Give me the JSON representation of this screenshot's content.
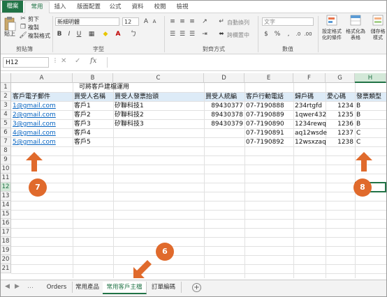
{
  "ribbon_tabs": [
    "檔案",
    "常用",
    "插入",
    "版面配置",
    "公式",
    "資料",
    "校閱",
    "檢視"
  ],
  "clipboard": {
    "paste": "貼上",
    "cut": "剪下",
    "copy": "複製",
    "format_painter": "複製格式",
    "group_label": "剪貼簿"
  },
  "font": {
    "name": "新細明體",
    "size": "12",
    "group_label": "字型"
  },
  "alignment": {
    "wrap": "自動換列",
    "merge": "跨欄置中",
    "group_label": "對齊方式"
  },
  "number": {
    "format": "文字",
    "group_label": "數值"
  },
  "styles": {
    "conditional": "設定格式化的條件",
    "format_table": "格式化為表格",
    "cell_styles": "儲存格樣式"
  },
  "formula_bar": {
    "name_box": "H12",
    "fx": "fx",
    "cancel": "✕",
    "confirm": "✓",
    "value": ""
  },
  "columns": [
    "A",
    "B",
    "C",
    "D",
    "E",
    "F",
    "G",
    "H"
  ],
  "rows": [
    "1",
    "2",
    "3",
    "4",
    "5",
    "6",
    "7",
    "8",
    "9",
    "10",
    "11",
    "12",
    "13",
    "14",
    "15",
    "16",
    "17",
    "18",
    "19",
    "20",
    "21"
  ],
  "title": "可將客戶建檔運用",
  "headers": [
    "客戶電子郵件",
    "買受人名稱",
    "買受人發票抬頭",
    "買受人統編",
    "客戶行動電話",
    "歸戶碼",
    "愛心碼",
    "發票類型"
  ],
  "data_rows": [
    [
      "1@gmail.com",
      "客戶1",
      "矽聯科技1",
      "89430377",
      "07-7190888",
      "234rtgfd",
      "1234",
      "B"
    ],
    [
      "2@gmail.com",
      "客戶2",
      "矽聯科技2",
      "89430378",
      "07-7190889",
      "1qwer432",
      "1235",
      "B"
    ],
    [
      "3@gmail.com",
      "客戶3",
      "矽聯科技3",
      "89430379",
      "07-7190890",
      "1234rewq",
      "1236",
      "B"
    ],
    [
      "4@gmail.com",
      "客戶4",
      "",
      "",
      "07-7190891",
      "aq12wsde",
      "1237",
      "C"
    ],
    [
      "5@gmail.com",
      "客戶5",
      "",
      "",
      "07-7190892",
      "12wsxzaq",
      "1238",
      "C"
    ]
  ],
  "annotations": {
    "badge_6": "6",
    "badge_7": "7",
    "badge_8": "8",
    "color": "#e06a2c"
  },
  "sheets": {
    "tabs": [
      "Orders",
      "常用產品",
      "常用客戶主檔",
      "訂單編碼"
    ],
    "active": "常用客戶主檔",
    "add": "+"
  },
  "colors": {
    "accent": "#217346",
    "header_fill": "#ddebf7",
    "link": "#0563c1"
  }
}
